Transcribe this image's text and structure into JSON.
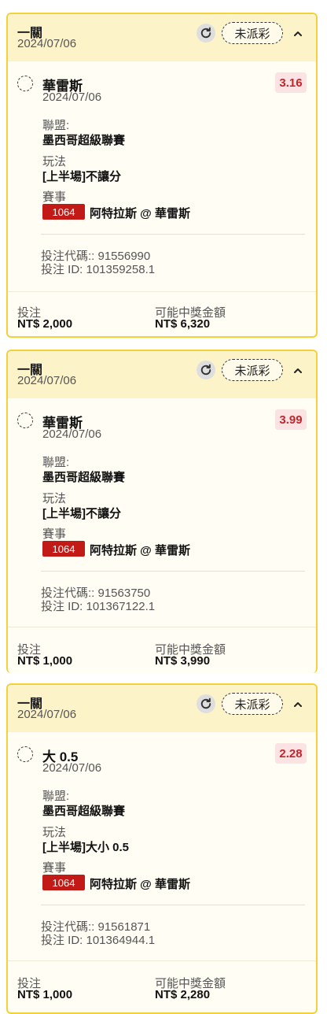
{
  "labels": {
    "league": "聯盟:",
    "bet_type": "玩法",
    "event": "賽事",
    "stake": "投注",
    "potential_win": "可能中獎金額"
  },
  "colors": {
    "card_border": "#f2d13c",
    "header_bg": "#fdf3c9",
    "odds_text": "#c0272d",
    "odds_bg": "#fbe3e3",
    "match_id_bg": "#c21b17"
  },
  "bets": [
    {
      "type": "一關",
      "date": "2024/07/06",
      "status": "未派彩",
      "selection": "華雷斯",
      "selection_date": "2024/07/06",
      "odds": "3.16",
      "league": "墨西哥超級聯賽",
      "bet_type": "[上半場]不讓分",
      "match_id": "1064",
      "match": "阿特拉斯 @ 華雷斯",
      "bet_code": "投注代碼:: 91556990",
      "bet_id": "投注 ID: 101359258.1",
      "stake": "NT$ 2,000",
      "potential_win": "NT$ 6,320"
    },
    {
      "type": "一關",
      "date": "2024/07/06",
      "status": "未派彩",
      "selection": "華雷斯",
      "selection_date": "2024/07/06",
      "odds": "3.99",
      "league": "墨西哥超級聯賽",
      "bet_type": "[上半場]不讓分",
      "match_id": "1064",
      "match": "阿特拉斯 @ 華雷斯",
      "bet_code": "投注代碼:: 91563750",
      "bet_id": "投注 ID: 101367122.1",
      "stake": "NT$ 1,000",
      "potential_win": "NT$ 3,990"
    },
    {
      "type": "一關",
      "date": "2024/07/06",
      "status": "未派彩",
      "selection": "大 0.5",
      "selection_date": "2024/07/06",
      "odds": "2.28",
      "league": "墨西哥超級聯賽",
      "bet_type": "[上半場]大小 0.5",
      "match_id": "1064",
      "match": "阿特拉斯 @ 華雷斯",
      "bet_code": "投注代碼:: 91561871",
      "bet_id": "投注 ID: 101364944.1",
      "stake": "NT$ 1,000",
      "potential_win": "NT$ 2,280"
    }
  ]
}
